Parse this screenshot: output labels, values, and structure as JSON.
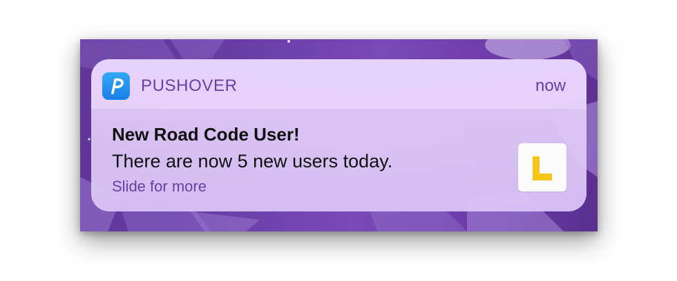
{
  "notification": {
    "app_name": "PUSHOVER",
    "time": "now",
    "title": "New Road Code User!",
    "message": "There are now 5 new users today.",
    "hint": "Slide for more",
    "app_icon": {
      "icon": "pushover-p-logo-icon",
      "letter": "P",
      "color": "#2a93f2"
    },
    "attachment": {
      "icon": "l-plate-icon",
      "letter": "L",
      "color": "#f5c518"
    }
  },
  "colors": {
    "accent": "#6243a2",
    "text": "#111111",
    "wallpaper": "#6a3da6"
  }
}
